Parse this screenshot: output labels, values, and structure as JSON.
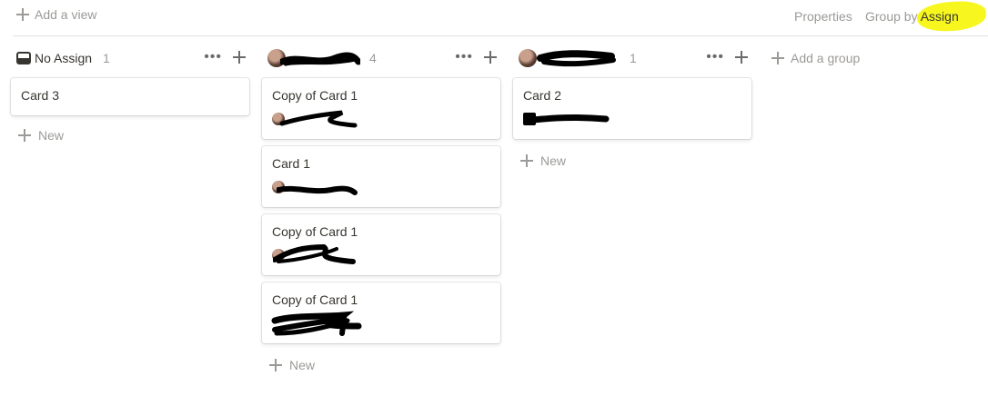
{
  "toolbar": {
    "add_view_label": "Add a view",
    "properties_label": "Properties",
    "group_by_prefix": "Group by",
    "group_by_value": "Assign",
    "highlight_color": "#f7f71f"
  },
  "add_group_label": "Add a group",
  "new_label": "New",
  "columns": [
    {
      "title": "No Assign",
      "count": "1",
      "cards": [
        {
          "title": "Card 3"
        }
      ]
    },
    {
      "title": "",
      "count": "4",
      "cards": [
        {
          "title": "Copy of Card 1"
        },
        {
          "title": "Card 1"
        },
        {
          "title": "Copy of Card 1"
        },
        {
          "title": "Copy of Card 1"
        }
      ]
    },
    {
      "title": "",
      "count": "1",
      "cards": [
        {
          "title": "Card 2"
        }
      ]
    }
  ],
  "icons": {
    "add": "plus-icon",
    "more": "more-icon",
    "no_assign": "inbox-icon"
  }
}
